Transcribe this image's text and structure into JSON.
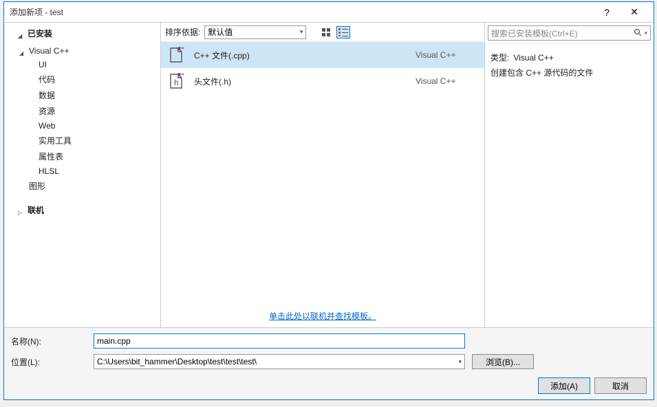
{
  "title": "添加新项 - test",
  "titlebar": {
    "help": "?",
    "close": "✕"
  },
  "tree": {
    "installed": "已安装",
    "cpp": "Visual C++",
    "children": [
      "UI",
      "代码",
      "数据",
      "资源",
      "Web",
      "实用工具",
      "属性表",
      "HLSL"
    ],
    "graphics": "图形",
    "online": "联机"
  },
  "sort": {
    "label": "排序依据:",
    "value": "默认值"
  },
  "templates": [
    {
      "name": "C++ 文件(.cpp)",
      "category": "Visual C++",
      "selected": true,
      "iconBadge": "++",
      "iconType": "cpp"
    },
    {
      "name": "头文件(.h)",
      "category": "Visual C++",
      "selected": false,
      "iconBadge": "++",
      "iconType": "h"
    }
  ],
  "onlineLink": "单击此处以联机并查找模板。",
  "right": {
    "searchPlaceholder": "搜索已安装模板(Ctrl+E)",
    "typeLabel": "类型:",
    "typeValue": "Visual C++",
    "description": "创建包含 C++ 源代码的文件"
  },
  "bottom": {
    "nameLabel": "名称(N):",
    "nameValue": "main.cpp",
    "locationLabel": "位置(L):",
    "locationValue": "C:\\Users\\bit_hammer\\Desktop\\test\\test\\test\\",
    "browse": "浏览(B)...",
    "add": "添加(A)",
    "cancel": "取消"
  }
}
